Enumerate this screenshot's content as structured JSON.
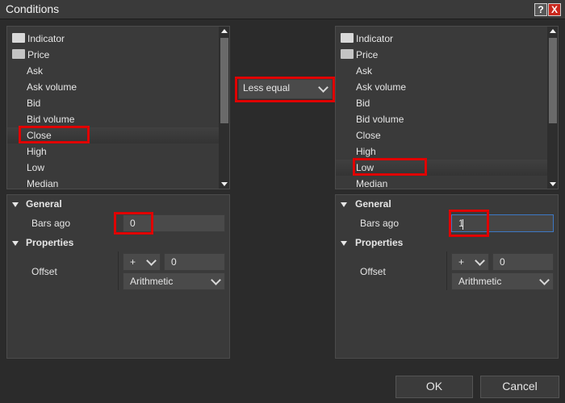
{
  "window": {
    "title": "Conditions",
    "help_label": "?",
    "close_label": "X"
  },
  "left": {
    "tree": [
      {
        "label": "Indicator"
      },
      {
        "label": "Price"
      },
      {
        "label": "Ask"
      },
      {
        "label": "Ask volume"
      },
      {
        "label": "Bid"
      },
      {
        "label": "Bid volume"
      },
      {
        "label": "Close"
      },
      {
        "label": "High"
      },
      {
        "label": "Low"
      },
      {
        "label": "Median"
      }
    ],
    "selected": "Close",
    "general_label": "General",
    "bars_ago_label": "Bars ago",
    "bars_ago_value": "0",
    "properties_label": "Properties",
    "offset_label": "Offset",
    "offset_op": "+",
    "offset_value": "0",
    "offset_type": "Arithmetic"
  },
  "operator": {
    "value": "Less equal"
  },
  "right": {
    "tree": [
      {
        "label": "Indicator"
      },
      {
        "label": "Price"
      },
      {
        "label": "Ask"
      },
      {
        "label": "Ask volume"
      },
      {
        "label": "Bid"
      },
      {
        "label": "Bid volume"
      },
      {
        "label": "Close"
      },
      {
        "label": "High"
      },
      {
        "label": "Low"
      },
      {
        "label": "Median"
      }
    ],
    "selected": "Low",
    "general_label": "General",
    "bars_ago_label": "Bars ago",
    "bars_ago_value": "1",
    "properties_label": "Properties",
    "offset_label": "Offset",
    "offset_op": "+",
    "offset_value": "0",
    "offset_type": "Arithmetic"
  },
  "buttons": {
    "ok": "OK",
    "cancel": "Cancel"
  }
}
